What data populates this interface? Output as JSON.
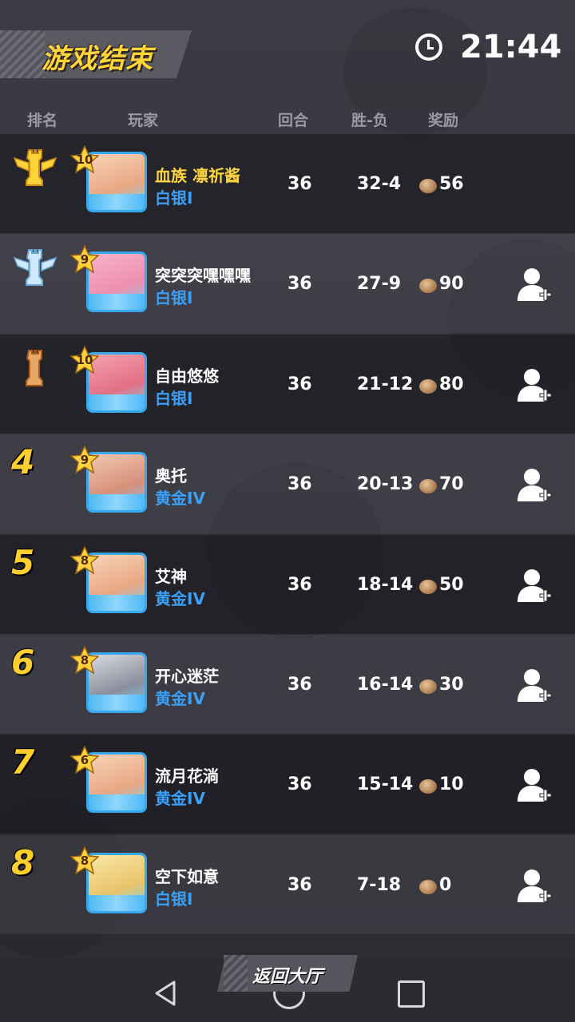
{
  "header": {
    "title": "游戏结束",
    "time": "21:44"
  },
  "columns": {
    "rank": "排名",
    "player": "玩家",
    "rounds": "回合",
    "win_loss": "胜-负",
    "reward": "奖励"
  },
  "rows": [
    {
      "rank": "1",
      "trophy": "gold-trophy-icon",
      "level": "10",
      "name": "血族  凛祈酱",
      "name_highlight": true,
      "tier": "白银I",
      "rounds": "36",
      "wl": "32-4",
      "reward": "56",
      "add_friend": false
    },
    {
      "rank": "2",
      "trophy": "silver-trophy-icon",
      "level": "9",
      "name": "突突突嘿嘿嘿",
      "name_highlight": false,
      "tier": "白银I",
      "rounds": "36",
      "wl": "27-9",
      "reward": "90",
      "add_friend": true
    },
    {
      "rank": "3",
      "trophy": "bronze-trophy-icon",
      "level": "10",
      "name": "自由悠悠",
      "name_highlight": false,
      "tier": "白银I",
      "rounds": "36",
      "wl": "21-12",
      "reward": "80",
      "add_friend": true
    },
    {
      "rank": "4",
      "trophy": "",
      "level": "9",
      "name": "奥托",
      "name_highlight": false,
      "tier": "黄金IV",
      "rounds": "36",
      "wl": "20-13",
      "reward": "70",
      "add_friend": true
    },
    {
      "rank": "5",
      "trophy": "",
      "level": "8",
      "name": "艾神",
      "name_highlight": false,
      "tier": "黄金IV",
      "rounds": "36",
      "wl": "18-14",
      "reward": "50",
      "add_friend": true
    },
    {
      "rank": "6",
      "trophy": "",
      "level": "8",
      "name": "开心迷茫",
      "name_highlight": false,
      "tier": "黄金IV",
      "rounds": "36",
      "wl": "16-14",
      "reward": "30",
      "add_friend": true
    },
    {
      "rank": "7",
      "trophy": "",
      "level": "6",
      "name": "流月花淌",
      "name_highlight": false,
      "tier": "黄金IV",
      "rounds": "36",
      "wl": "15-14",
      "reward": "10",
      "add_friend": true
    },
    {
      "rank": "8",
      "trophy": "",
      "level": "8",
      "name": "空下如意",
      "name_highlight": false,
      "tier": "白银I",
      "rounds": "36",
      "wl": "7-18",
      "reward": "0",
      "add_friend": true
    }
  ],
  "footer": {
    "back_lobby": "返回大厅"
  },
  "colors": {
    "accent_gold": "#ffd53a",
    "tier_blue": "#3b9ff5",
    "avatar_border": "#38a8ee"
  }
}
